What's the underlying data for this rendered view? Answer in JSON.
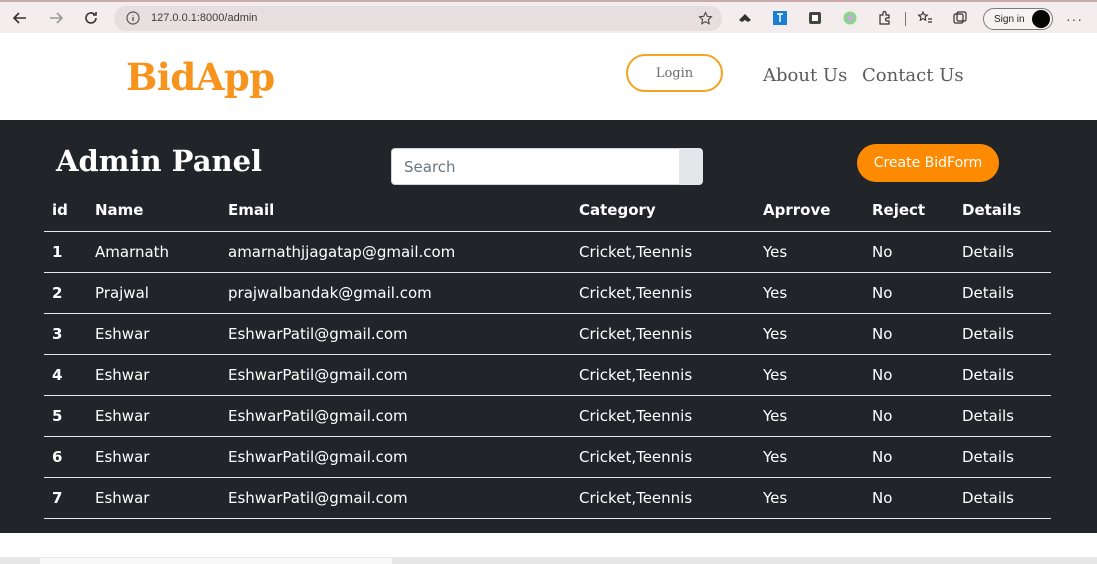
{
  "browser": {
    "url": "127.0.0.1:8000/admin",
    "signin_label": "Sign in",
    "more_label": "···"
  },
  "site": {
    "brand": "BidApp",
    "login_label": "Login",
    "nav": [
      "About Us",
      "Contact Us"
    ],
    "colors": {
      "brand": "#f7941d",
      "accent": "#fd8a00",
      "panel_bg": "#212429"
    }
  },
  "panel": {
    "title": "Admin Panel",
    "search_placeholder": "Search",
    "create_label": "Create BidForm"
  },
  "table": {
    "headers": [
      "id",
      "Name",
      "Email",
      "Category",
      "Aprrove",
      "Reject",
      "Details"
    ],
    "rows": [
      [
        "1",
        "Amarnath",
        "amarnathjjagatap@gmail.com",
        "Cricket,Teennis",
        "Yes",
        "No",
        "Details"
      ],
      [
        "2",
        "Prajwal",
        "prajwalbandak@gmail.com",
        "Cricket,Teennis",
        "Yes",
        "No",
        "Details"
      ],
      [
        "3",
        "Eshwar",
        "EshwarPatil@gmail.com",
        "Cricket,Teennis",
        "Yes",
        "No",
        "Details"
      ],
      [
        "4",
        "Eshwar",
        "EshwarPatil@gmail.com",
        "Cricket,Teennis",
        "Yes",
        "No",
        "Details"
      ],
      [
        "5",
        "Eshwar",
        "EshwarPatil@gmail.com",
        "Cricket,Teennis",
        "Yes",
        "No",
        "Details"
      ],
      [
        "6",
        "Eshwar",
        "EshwarPatil@gmail.com",
        "Cricket,Teennis",
        "Yes",
        "No",
        "Details"
      ],
      [
        "7",
        "Eshwar",
        "EshwarPatil@gmail.com",
        "Cricket,Teennis",
        "Yes",
        "No",
        "Details"
      ]
    ]
  }
}
